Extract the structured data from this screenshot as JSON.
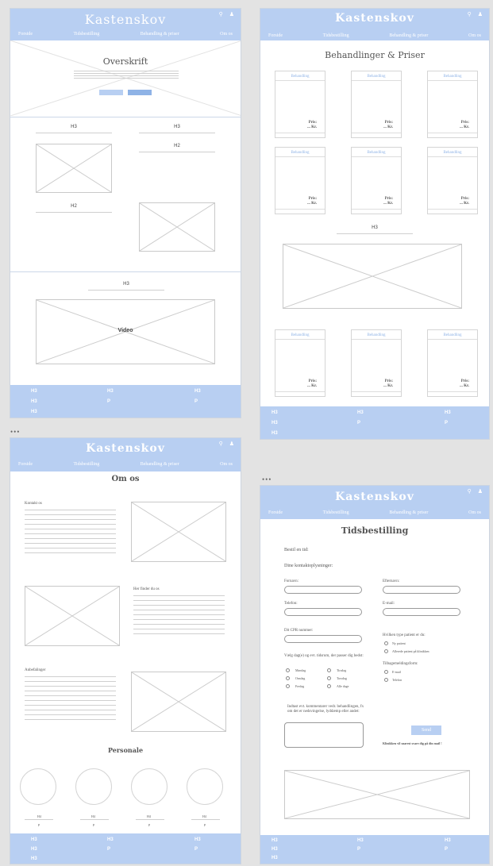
{
  "brand": "Kastenskov",
  "nav": [
    "Forside",
    "Tidsbestilling",
    "Behandling & priser",
    "Om os"
  ],
  "icons": [
    "search-icon",
    "user-icon"
  ],
  "footer": {
    "row1": [
      "H3",
      "H3",
      "H3"
    ],
    "row2": [
      "H3",
      "P",
      "P"
    ],
    "row3": [
      "H3"
    ]
  },
  "dots": "•••",
  "home": {
    "hero_title": "Overskrift",
    "section_h3a": "H3",
    "section_h3b": "H3",
    "section_h2a": "H2",
    "section_h2b": "H2",
    "video_h3": "H3",
    "video_label": "Video"
  },
  "treatments": {
    "title": "Behandlinger & Priser",
    "card_title": "Behandling",
    "price_label": "Pris:",
    "price_value": "... Kr.",
    "mid_h3": "H3"
  },
  "about": {
    "title": "Om os",
    "contact": "Kontakt os",
    "find_us": "Her finder du os",
    "team_section": "Anbefalinger",
    "staff_title": "Personale",
    "staff_h": [
      "H4",
      "H4",
      "H4",
      "H4"
    ],
    "staff_p": [
      "P",
      "P",
      "P",
      "P"
    ]
  },
  "booking": {
    "title": "Tidsbestilling",
    "book_label": "Bestil en tid:",
    "contact_label": "Dine kontaktoplysninger:",
    "fornavn": "Fornavn:",
    "efternavn": "Efternavn:",
    "telefon": "Telefon:",
    "email": "E-mail:",
    "cpr": "Dit CPR nummer:",
    "patient_type_q": "Hvilken type patient er du:",
    "patient_new": "Ny patient",
    "patient_existing": "Allerede patient på klinikken",
    "days_q": "Vælg dag(e) og evt. tidsrum, der passer dig bedst:",
    "days": [
      "Mandag",
      "Tirsdag",
      "Onsdag",
      "Torsdag",
      "Fredag",
      "Alle dage"
    ],
    "contact_method_q": "Tilbagemeldingsform:",
    "contact_methods": [
      "E-mail",
      "Telefon"
    ],
    "note_label": "Indtast evt. kommentarer vedr. behandlingen, fx om det er nedsvingelse, lyddæmp eller andet:",
    "send_button": "Send",
    "confirm": "Klinikken vil snarest svare dig på din mail !"
  }
}
